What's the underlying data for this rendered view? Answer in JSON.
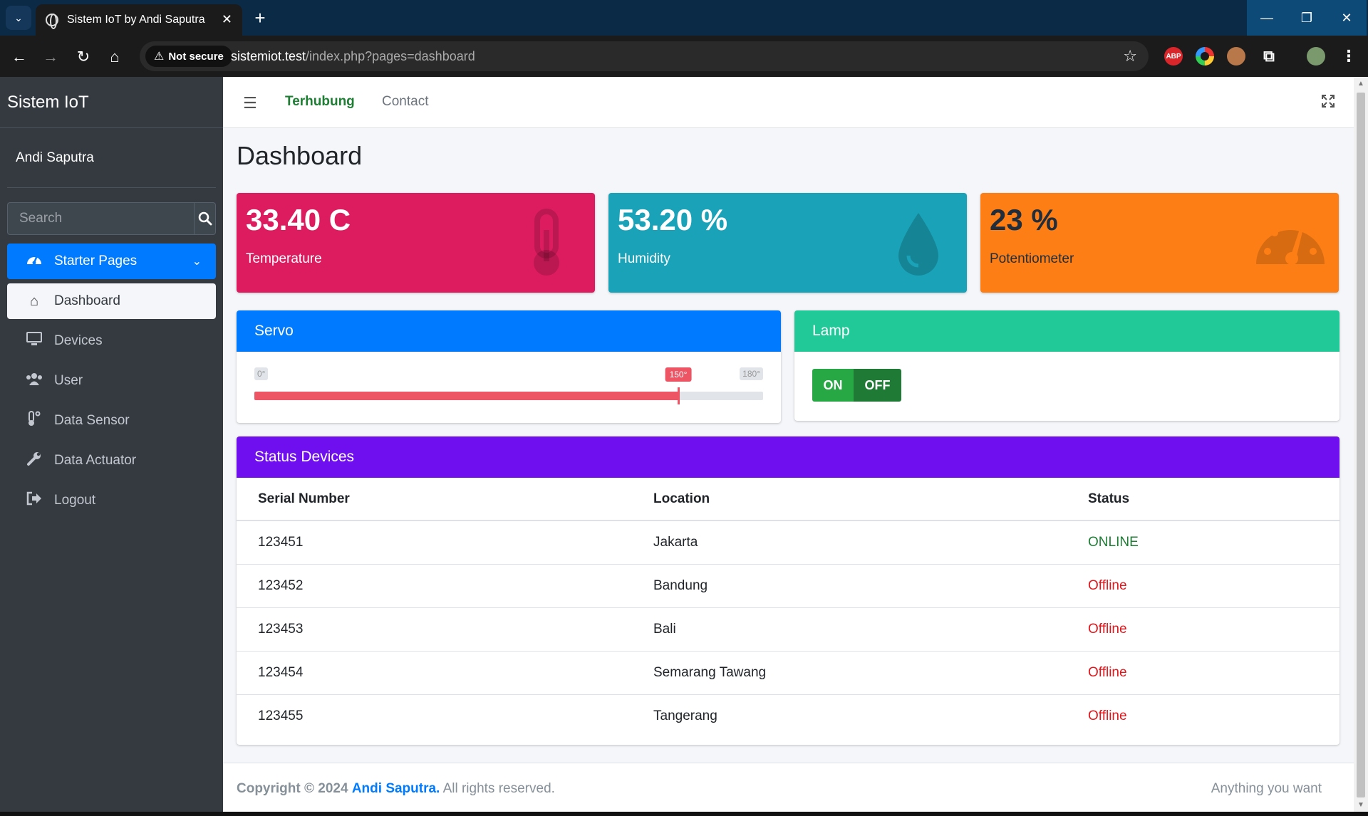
{
  "browser": {
    "tab_title": "Sistem IoT by Andi Saputra",
    "security_label": "Not secure",
    "url_host": "sistemiot.test",
    "url_path": "/index.php?pages=dashboard",
    "ext_abp": "ABP"
  },
  "sidebar": {
    "brand": "Sistem IoT",
    "user_name": "Andi Saputra",
    "search_placeholder": "Search",
    "starter_label": "Starter Pages",
    "items": [
      {
        "label": "Dashboard",
        "icon": "home-icon"
      },
      {
        "label": "Devices",
        "icon": "desktop-icon"
      },
      {
        "label": "User",
        "icon": "users-icon"
      },
      {
        "label": "Data Sensor",
        "icon": "thermometer-icon"
      },
      {
        "label": "Data Actuator",
        "icon": "wrench-icon"
      },
      {
        "label": "Logout",
        "icon": "logout-icon"
      }
    ]
  },
  "topnav": {
    "link1": "Terhubung",
    "link2": "Contact"
  },
  "page_title": "Dashboard",
  "stats": {
    "temperature": {
      "value": "33.40 C",
      "label": "Temperature",
      "color": "#dc1c5e"
    },
    "humidity": {
      "value": "53.20 %",
      "label": "Humidity",
      "color": "#1aa3b8"
    },
    "potentiometer": {
      "value": "23 %",
      "label": "Potentiometer",
      "color": "#fd7e14"
    }
  },
  "servo": {
    "title": "Servo",
    "min_label": "0°",
    "max_label": "180°",
    "current_label": "150°",
    "min": 0,
    "max": 180,
    "value": 150
  },
  "lamp": {
    "title": "Lamp",
    "on_label": "ON",
    "off_label": "OFF"
  },
  "status_devices": {
    "title": "Status Devices",
    "columns": [
      "Serial Number",
      "Location",
      "Status"
    ],
    "rows": [
      {
        "serial": "123451",
        "location": "Jakarta",
        "status": "ONLINE"
      },
      {
        "serial": "123452",
        "location": "Bandung",
        "status": "Offline"
      },
      {
        "serial": "123453",
        "location": "Bali",
        "status": "Offline"
      },
      {
        "serial": "123454",
        "location": "Semarang Tawang",
        "status": "Offline"
      },
      {
        "serial": "123455",
        "location": "Tangerang",
        "status": "Offline"
      }
    ]
  },
  "footer": {
    "copyright": "Copyright © 2024",
    "author": "Andi Saputra.",
    "rights": "All rights reserved.",
    "right_text": "Anything you want"
  }
}
